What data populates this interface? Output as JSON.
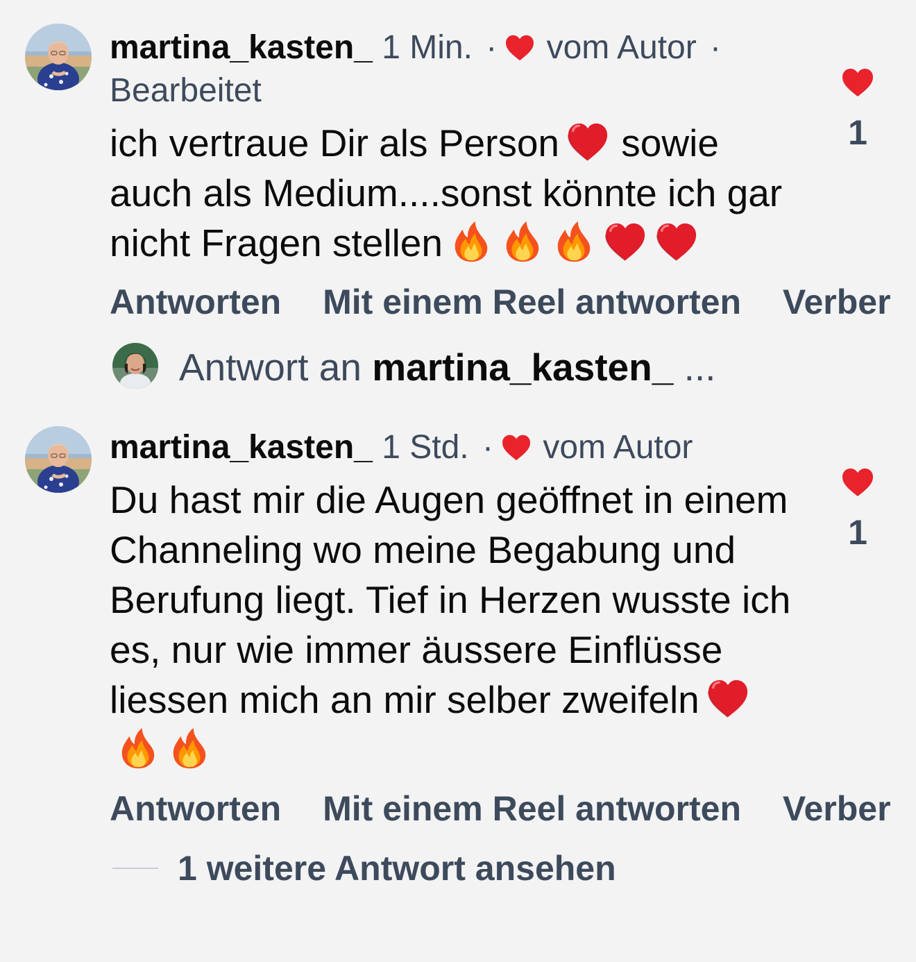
{
  "colors": {
    "background": "#f3f3f4",
    "heart": "#e8232c",
    "secondary_text": "#3d4a5c"
  },
  "comments": [
    {
      "username": "martina_kasten_",
      "time": "1 Min.",
      "separator": "·",
      "liked_by_author": "vom Autor",
      "edited_separator": "·",
      "edited": "Bearbeitet",
      "text": "ich vertraue Dir als Person❤️ sowie auch als Medium....sonst könnte ich gar nicht Fragen stellen🔥🔥🔥❤️❤️",
      "like_count": "1",
      "actions": {
        "reply": "Antworten",
        "reply_reel": "Mit einem Reel antworten",
        "translate": "Verber"
      }
    },
    {
      "username": "martina_kasten_",
      "time": "1 Std.",
      "separator": "·",
      "liked_by_author": "vom Autor",
      "text": "Du hast mir die Augen geöffnet in einem Channeling wo meine Begabung und Berufung liegt. Tief in Herzen wusste ich es, nur wie immer äussere Einflüsse liessen mich an mir selber zweifeln❤️🔥🔥",
      "like_count": "1",
      "actions": {
        "reply": "Antworten",
        "reply_reel": "Mit einem Reel antworten",
        "translate": "Verber"
      }
    }
  ],
  "reply_preview": {
    "prefix": "Antwort an",
    "username": "martina_kasten_",
    "ellipsis": "..."
  },
  "more_replies": "1 weitere Antwort ansehen"
}
